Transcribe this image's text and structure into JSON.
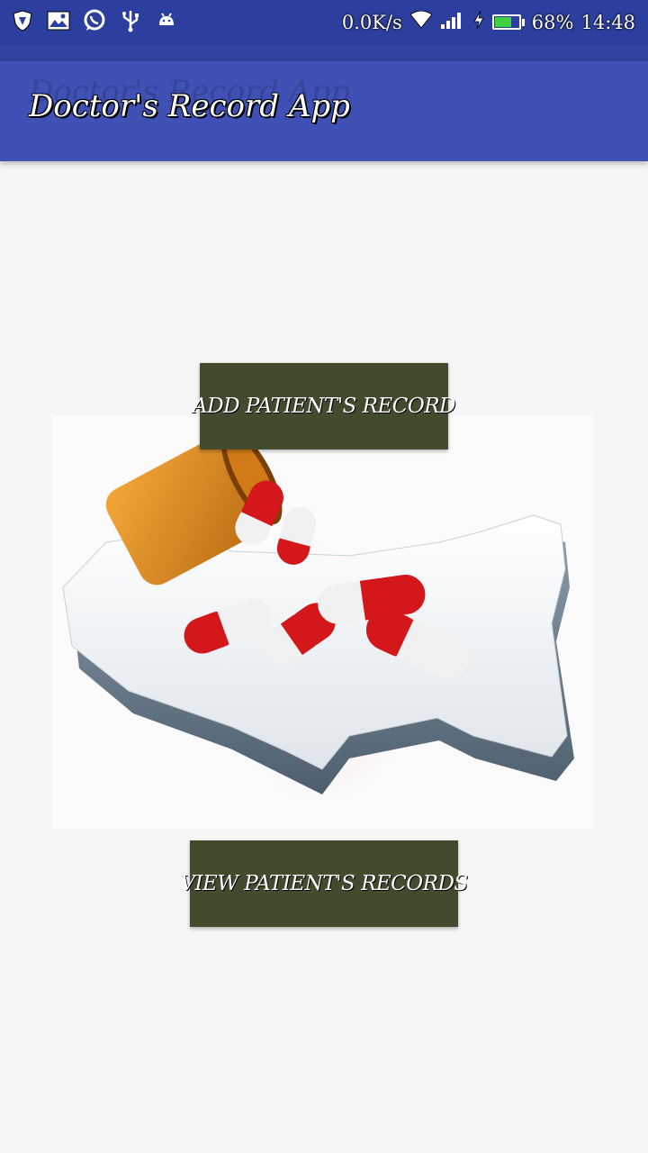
{
  "status_bar": {
    "icons": [
      "shield-icon",
      "gallery-icon",
      "whatsapp-icon",
      "usb-icon",
      "android-icon"
    ],
    "network_speed": "0.0K/s",
    "battery_percent": "68%",
    "battery_level": 0.68,
    "time": "14:48"
  },
  "app_bar": {
    "title": "Doctor's Record App",
    "color": "#3f51b5"
  },
  "main": {
    "add_button_label": "ADD PATIENT'S RECORD",
    "view_button_label": "VIEW PATIENT'S RECORDS",
    "button_color": "#424b2e",
    "hero_image": "pills-on-usa-map"
  }
}
